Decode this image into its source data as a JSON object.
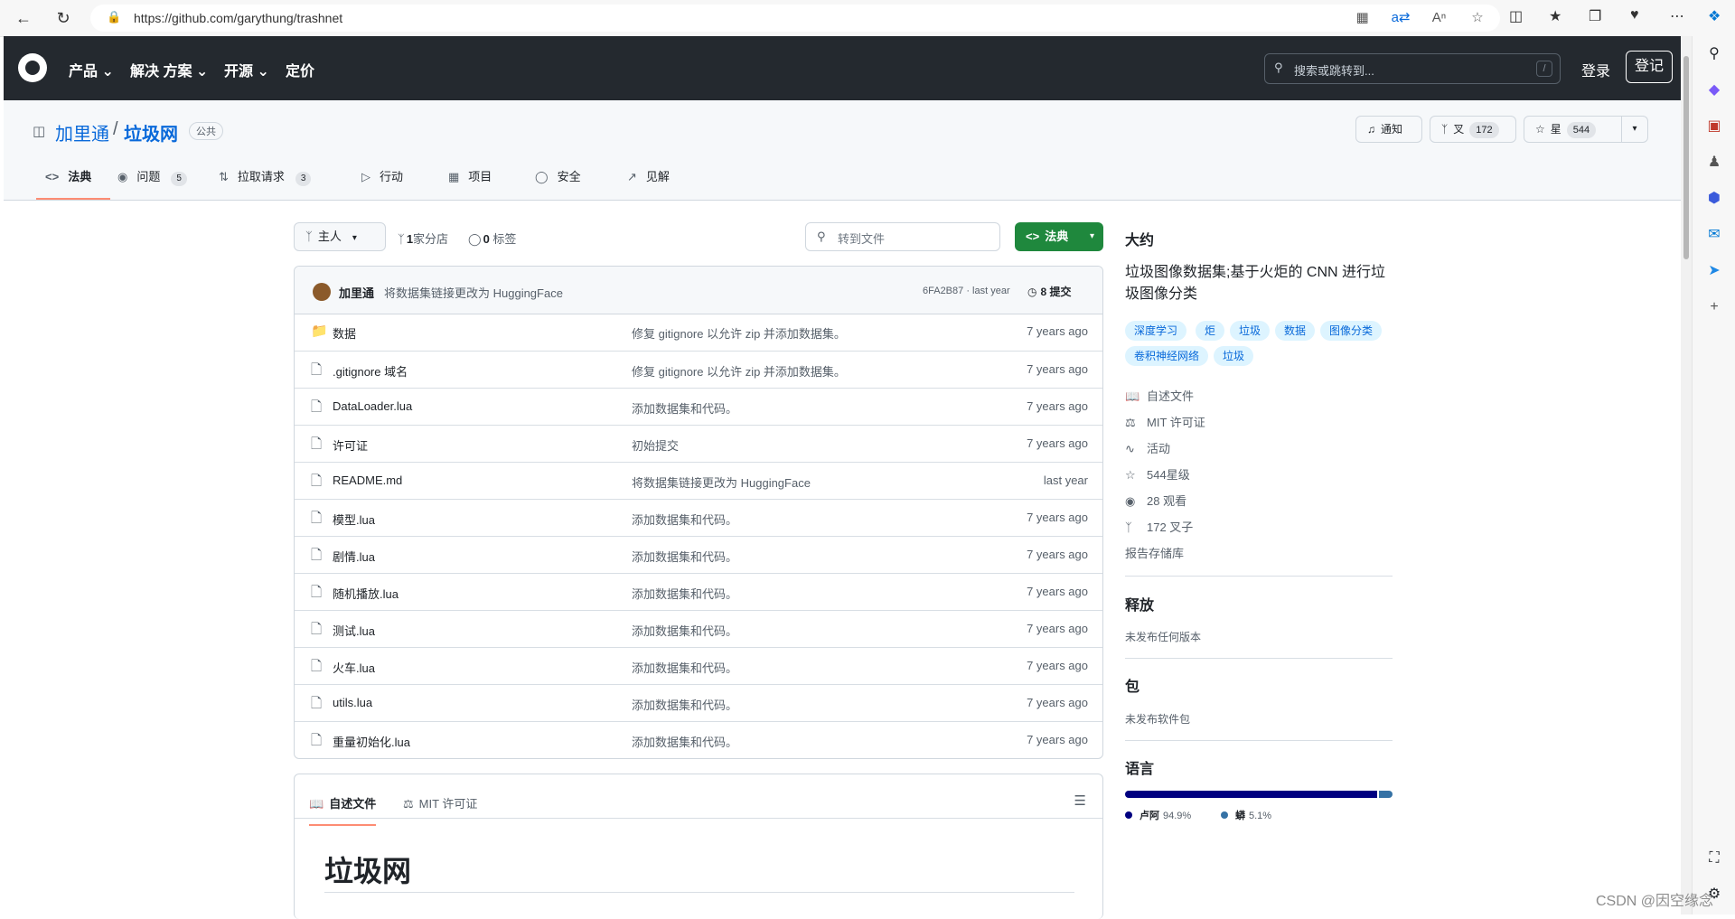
{
  "browser": {
    "url": "https://github.com/garythung/trashnet"
  },
  "header": {
    "nav": [
      "产品",
      "解决 方案",
      "开源",
      "定价"
    ],
    "search_placeholder": "搜索或跳转到...",
    "search_key": "/",
    "signin": "登录",
    "signup": "登记"
  },
  "repo": {
    "owner": "加里通",
    "separator": "/",
    "name": "垃圾网",
    "visibility": "公共",
    "notify": "通知",
    "fork_label": "叉",
    "fork_count": "172",
    "star_label": "星",
    "star_count": "544",
    "tabs": [
      {
        "label": "法典",
        "count": ""
      },
      {
        "label": "问题",
        "count": "5"
      },
      {
        "label": "拉取请求",
        "count": "3"
      },
      {
        "label": "行动",
        "count": ""
      },
      {
        "label": "项目",
        "count": ""
      },
      {
        "label": "安全",
        "count": ""
      },
      {
        "label": "见解",
        "count": ""
      }
    ]
  },
  "toolbar": {
    "branch": "主人",
    "branches_num": "1",
    "branches_label": "家分店",
    "tags_num": "0",
    "tags_label": "标签",
    "goto_file": "转到文件",
    "code_button": "法典"
  },
  "commit": {
    "author": "加里通",
    "message": "将数据集链接更改为 HuggingFace",
    "hash": "6FA2B87 · last year",
    "count": "8 提交"
  },
  "files": [
    {
      "name": "数据",
      "type": "dir",
      "message": "修复 gitignore 以允许 zip 并添加数据集。",
      "time": "7 years ago"
    },
    {
      "name": ".gitignore 域名",
      "type": "file",
      "message": "修复 gitignore 以允许 zip 并添加数据集。",
      "time": "7 years ago"
    },
    {
      "name": "DataLoader.lua",
      "type": "file",
      "message": "添加数据集和代码。",
      "time": "7 years ago"
    },
    {
      "name": "许可证",
      "type": "file",
      "message": "初始提交",
      "time": "7 years ago"
    },
    {
      "name": "README.md",
      "type": "file",
      "message": "将数据集链接更改为 HuggingFace",
      "time": "last year"
    },
    {
      "name": "模型.lua",
      "type": "file",
      "message": "添加数据集和代码。",
      "time": "7 years ago"
    },
    {
      "name": "剧情.lua",
      "type": "file",
      "message": "添加数据集和代码。",
      "time": "7 years ago"
    },
    {
      "name": "随机播放.lua",
      "type": "file",
      "message": "添加数据集和代码。",
      "time": "7 years ago"
    },
    {
      "name": "测试.lua",
      "type": "file",
      "message": "添加数据集和代码。",
      "time": "7 years ago"
    },
    {
      "name": "火车.lua",
      "type": "file",
      "message": "添加数据集和代码。",
      "time": "7 years ago"
    },
    {
      "name": "utils.lua",
      "type": "file",
      "message": "添加数据集和代码。",
      "time": "7 years ago"
    },
    {
      "name": "重量初始化.lua",
      "type": "file",
      "message": "添加数据集和代码。",
      "time": "7 years ago"
    }
  ],
  "readme": {
    "tab_readme": "自述文件",
    "tab_license": "MIT 许可证",
    "title": "垃圾网"
  },
  "about": {
    "heading": "大约",
    "description": "垃圾图像数据集;基于火炬的 CNN 进行垃圾图像分类",
    "topics": [
      "深度学习",
      "炬",
      "垃圾",
      "数据",
      "图像分类",
      "卷积神经网络",
      "垃圾"
    ],
    "readme": "自述文件",
    "license": "MIT 许可证",
    "activity": "活动",
    "stars": "544星级",
    "watchers": "28 观看",
    "forks": "172 叉子",
    "report": "报告存储库"
  },
  "releases": {
    "heading": "释放",
    "text": "未发布任何版本"
  },
  "packages": {
    "heading": "包",
    "text": "未发布软件包"
  },
  "languages": {
    "heading": "语言",
    "items": [
      {
        "name": "卢阿",
        "percent": 94.9,
        "percent_label": "94.9%",
        "color": "#000080"
      },
      {
        "name": "蟒",
        "percent": 5.1,
        "percent_label": "5.1%",
        "color": "#3572A5"
      }
    ]
  },
  "watermark": "CSDN @因空缘念"
}
